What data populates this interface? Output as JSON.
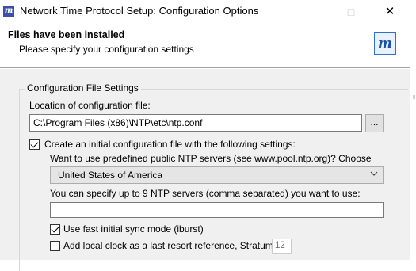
{
  "window": {
    "title": "Network Time Protocol Setup: Configuration Options",
    "icons": {
      "app": "m-logo-icon",
      "minimize": "minimize-icon",
      "maximize": "maximize-icon",
      "close": "close-icon"
    }
  },
  "header": {
    "title": "Files have been installed",
    "subtitle": "Please specify your configuration settings",
    "logo_icon": "m-logo-icon"
  },
  "config": {
    "group_label": "Configuration File Settings",
    "location_label": "Location of configuration file:",
    "location_value": "C:\\Program Files (x86)\\NTP\\etc\\ntp.conf",
    "browse_label": "...",
    "create_initial": {
      "label": "Create an initial configuration file with the following settings:",
      "checked": true
    },
    "predefined_label": "Want to use predefined public NTP servers (see www.pool.ntp.org)? Choose",
    "country_selected": "United States of America",
    "servers_label": "You can specify up to 9 NTP servers (comma separated) you want to use:",
    "servers_value": "",
    "fast_sync": {
      "label": "Use fast initial sync mode (iburst)",
      "checked": true
    },
    "local_clock": {
      "label": "Add local clock as a last resort reference, Stratum:",
      "checked": false
    },
    "stratum_value": "12"
  }
}
